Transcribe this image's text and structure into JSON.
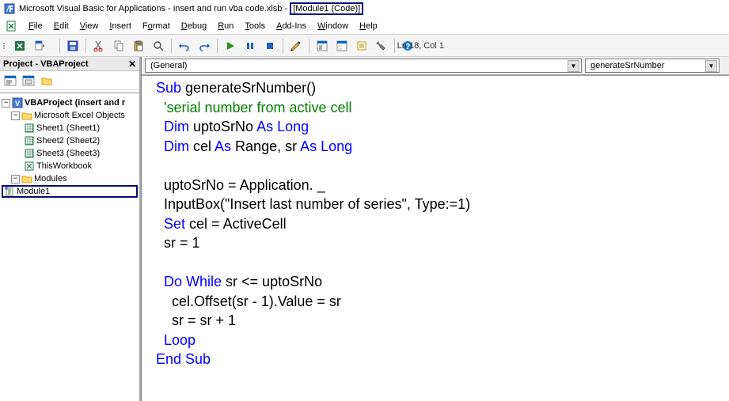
{
  "title": {
    "app": "Microsoft Visual Basic for Applications - insert and run vba code.xlsb - ",
    "doc": "[Module1 (Code)]"
  },
  "menu": {
    "file": "File",
    "edit": "Edit",
    "view": "View",
    "insert": "Insert",
    "format": "Format",
    "debug": "Debug",
    "run": "Run",
    "tools": "Tools",
    "addins": "Add-Ins",
    "window": "Window",
    "help": "Help"
  },
  "toolbar": {
    "status": "Ln 18, Col 1"
  },
  "sidebar": {
    "title": "Project - VBAProject",
    "root": "VBAProject (insert and r",
    "excel_folder": "Microsoft Excel Objects",
    "sheets": [
      "Sheet1 (Sheet1)",
      "Sheet2 (Sheet2)",
      "Sheet3 (Sheet3)"
    ],
    "workbook": "ThisWorkbook",
    "modules_folder": "Modules",
    "module1": "Module1"
  },
  "dropdowns": {
    "left": "(General)",
    "right": "generateSrNumber"
  },
  "code": {
    "l1a": "Sub",
    "l1b": " generateSrNumber()",
    "l2": "  'serial number from active cell",
    "l3a": "  Dim",
    "l3b": " uptoSrNo ",
    "l3c": "As Long",
    "l4a": "  Dim",
    "l4b": " cel ",
    "l4c": "As",
    "l4d": " Range, sr ",
    "l4e": "As Long",
    "l5": "  ",
    "l6": "  uptoSrNo = Application. _",
    "l7": "  InputBox(\"Insert last number of series\", Type:=1)",
    "l8a": "  Set",
    "l8b": " cel = ActiveCell",
    "l9": "  sr = 1",
    "l10": "  ",
    "l11a": "  Do While",
    "l11b": " sr <= uptoSrNo",
    "l12": "    cel.Offset(sr - 1).Value = sr",
    "l13": "    sr = sr + 1",
    "l14": "  Loop",
    "l15": "End Sub"
  }
}
